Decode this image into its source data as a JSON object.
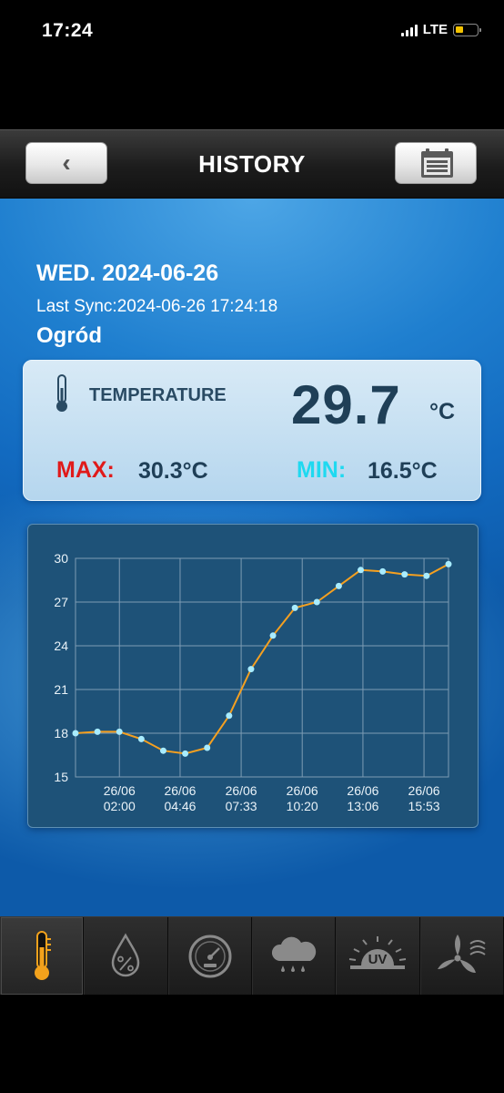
{
  "status_bar": {
    "time": "17:24",
    "network": "LTE",
    "battery_level": 0.35
  },
  "header": {
    "title": "HISTORY",
    "back_icon": "‹"
  },
  "summary": {
    "date": "WED. 2024-06-26",
    "last_sync": "Last Sync:2024-06-26 17:24:18",
    "location": "Ogród"
  },
  "temperature": {
    "label": "TEMPERATURE",
    "value": "29.7",
    "unit": "°C",
    "max_label": "MAX:",
    "max_value": "30.3°C",
    "min_label": "MIN:",
    "min_value": "16.5°C"
  },
  "chart_data": {
    "type": "line",
    "x_tick_labels": [
      [
        "26/06",
        "02:00"
      ],
      [
        "26/06",
        "04:46"
      ],
      [
        "26/06",
        "07:33"
      ],
      [
        "26/06",
        "10:20"
      ],
      [
        "26/06",
        "13:06"
      ],
      [
        "26/06",
        "15:53"
      ]
    ],
    "y_ticks": [
      15,
      18,
      21,
      24,
      27,
      30
    ],
    "ylim": [
      15,
      30
    ],
    "x_ticks_hours": [
      2.0,
      4.767,
      7.55,
      10.333,
      13.1,
      15.883
    ],
    "xlim_hours": [
      0.0,
      17.0
    ],
    "series": [
      {
        "x_hours": [
          0.0,
          1.0,
          2.0,
          3.0,
          4.0,
          5.0,
          6.0,
          7.0,
          8.0,
          9.0,
          10.0,
          11.0,
          12.0,
          13.0,
          14.0,
          15.0,
          16.0,
          17.0
        ],
        "values": [
          18.0,
          18.1,
          18.1,
          17.6,
          16.8,
          16.6,
          17.0,
          19.2,
          22.4,
          24.7,
          26.6,
          27.0,
          28.1,
          29.2,
          29.1,
          28.9,
          28.8,
          29.6
        ]
      }
    ],
    "grid": true,
    "colors": {
      "line": "#f5a020",
      "point": "#a8ecff",
      "grid": "#7d9cb4",
      "axis_text": "#e9f2f8"
    }
  },
  "tabs": [
    {
      "name": "temperature",
      "icon": "thermometer-icon",
      "active": true
    },
    {
      "name": "humidity",
      "icon": "humidity-drop-icon",
      "active": false
    },
    {
      "name": "pressure",
      "icon": "barometer-gauge-icon",
      "active": false
    },
    {
      "name": "rain",
      "icon": "rain-cloud-icon",
      "active": false
    },
    {
      "name": "uv",
      "icon": "uv-sun-icon",
      "active": false,
      "text": "UV"
    },
    {
      "name": "wind",
      "icon": "wind-turbine-icon",
      "active": false
    }
  ]
}
